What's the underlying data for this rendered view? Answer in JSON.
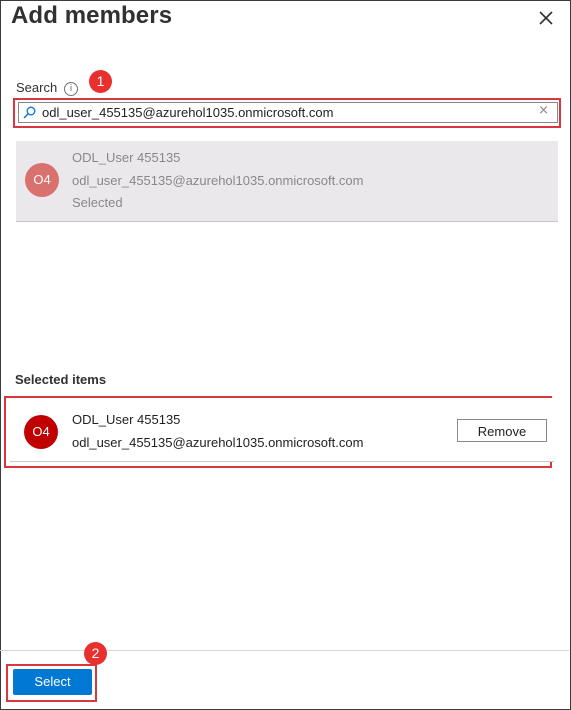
{
  "dialog": {
    "title": "Add members",
    "close_icon": "close-icon"
  },
  "search": {
    "label": "Search",
    "info_icon": "info-icon",
    "info_glyph": "i",
    "value": "odl_user_455135@azurehol1035.onmicrosoft.com",
    "clear_glyph": "×"
  },
  "result": {
    "initials": "O4",
    "name": "ODL_User 455135",
    "email": "odl_user_455135@azurehol1035.onmicrosoft.com",
    "status": "Selected",
    "avatar_color": "#d9716e"
  },
  "selected_section": {
    "heading": "Selected items",
    "items": [
      {
        "initials": "O4",
        "name": "ODL_User 455135",
        "email": "odl_user_455135@azurehol1035.onmicrosoft.com",
        "remove_label": "Remove",
        "avatar_color": "#c00000"
      }
    ]
  },
  "footer": {
    "select_label": "Select"
  },
  "annotations": {
    "step1": "1",
    "step2": "2",
    "highlight_color": "#d9363e"
  },
  "colors": {
    "accent": "#0078d4",
    "badge": "#e8312f"
  }
}
